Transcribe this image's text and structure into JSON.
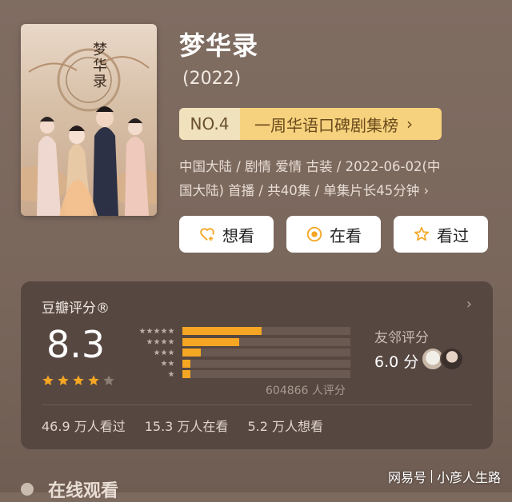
{
  "show": {
    "title": "梦华录",
    "year": "(2022)",
    "poster_title": "梦华录"
  },
  "ranking": {
    "number": "NO.4",
    "list_name": "一周华语口碑剧集榜",
    "arrow": "›"
  },
  "info": {
    "line1": "中国大陆 / 剧情 爱情 古装 / 2022-06-02(中",
    "line2": "国大陆) 首播 / 共40集 / 单集片长45分钟 ›"
  },
  "actions": {
    "want_label": "想看",
    "watching_label": "在看",
    "watched_label": "看过"
  },
  "rating": {
    "label": "豆瓣评分®",
    "arrow": "›",
    "score": "8.3",
    "stars_filled": 4,
    "stars_total": 5,
    "distribution": [
      {
        "stars": 5,
        "fraction": 0.47
      },
      {
        "stars": 4,
        "fraction": 0.34
      },
      {
        "stars": 3,
        "fraction": 0.11
      },
      {
        "stars": 2,
        "fraction": 0.04
      },
      {
        "stars": 1,
        "fraction": 0.04
      }
    ],
    "count_text": "604866 人评分",
    "friend_label": "友邻评分",
    "friend_score": "6.0 分",
    "stats": {
      "watched": "46.9 万人看过",
      "watching": "15.3 万人在看",
      "want": "5.2 万人想看"
    }
  },
  "bottom": {
    "section_title": "在线观看"
  },
  "watermark": {
    "brand": "网易号",
    "author": "小彦人生路"
  },
  "colors": {
    "background": "#7d6a5f",
    "card": "#564741",
    "accent": "#f5a623",
    "rank_bg": "#f6d27e"
  }
}
